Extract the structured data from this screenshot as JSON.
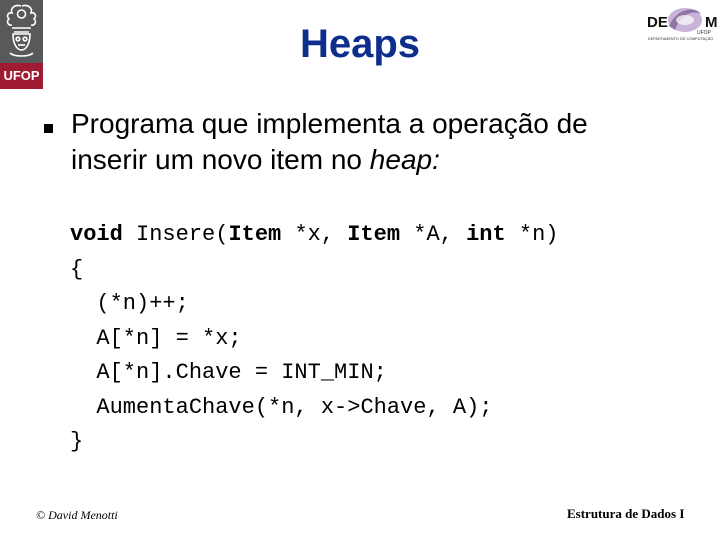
{
  "logos": {
    "left": {
      "text": "UFOP",
      "icon": "ufop-crest-icon"
    },
    "right": {
      "text_left": "DE",
      "text_right": "M",
      "sub_small": "UFOP",
      "sub": "DEPARTAMENTO DE COMPUTAÇÃO",
      "icon": "decom-swoosh-icon"
    }
  },
  "slide": {
    "title": "Heaps",
    "bullet": {
      "text_before": "Programa que implementa a operação de inserir um novo item no ",
      "text_italic": "heap:"
    },
    "code": {
      "line1": {
        "kw1": "void",
        "t1": " Insere(",
        "kw2": "Item",
        "t2": " *x, ",
        "kw3": "Item",
        "t3": " *A, ",
        "kw4": "int",
        "t4": " *n)"
      },
      "lines": [
        "{",
        "  (*n)++;",
        "  A[*n] = *x;",
        "  A[*n].Chave = INT_MIN;",
        "  AumentaChave(*n, x->Chave, A);",
        "}"
      ]
    }
  },
  "footer": {
    "left": "© David Menotti",
    "right": "Estrutura de Dados I"
  },
  "colors": {
    "title": "#0d2e8c",
    "ufop_gray": "#58595b",
    "ufop_red": "#9e1b32"
  }
}
